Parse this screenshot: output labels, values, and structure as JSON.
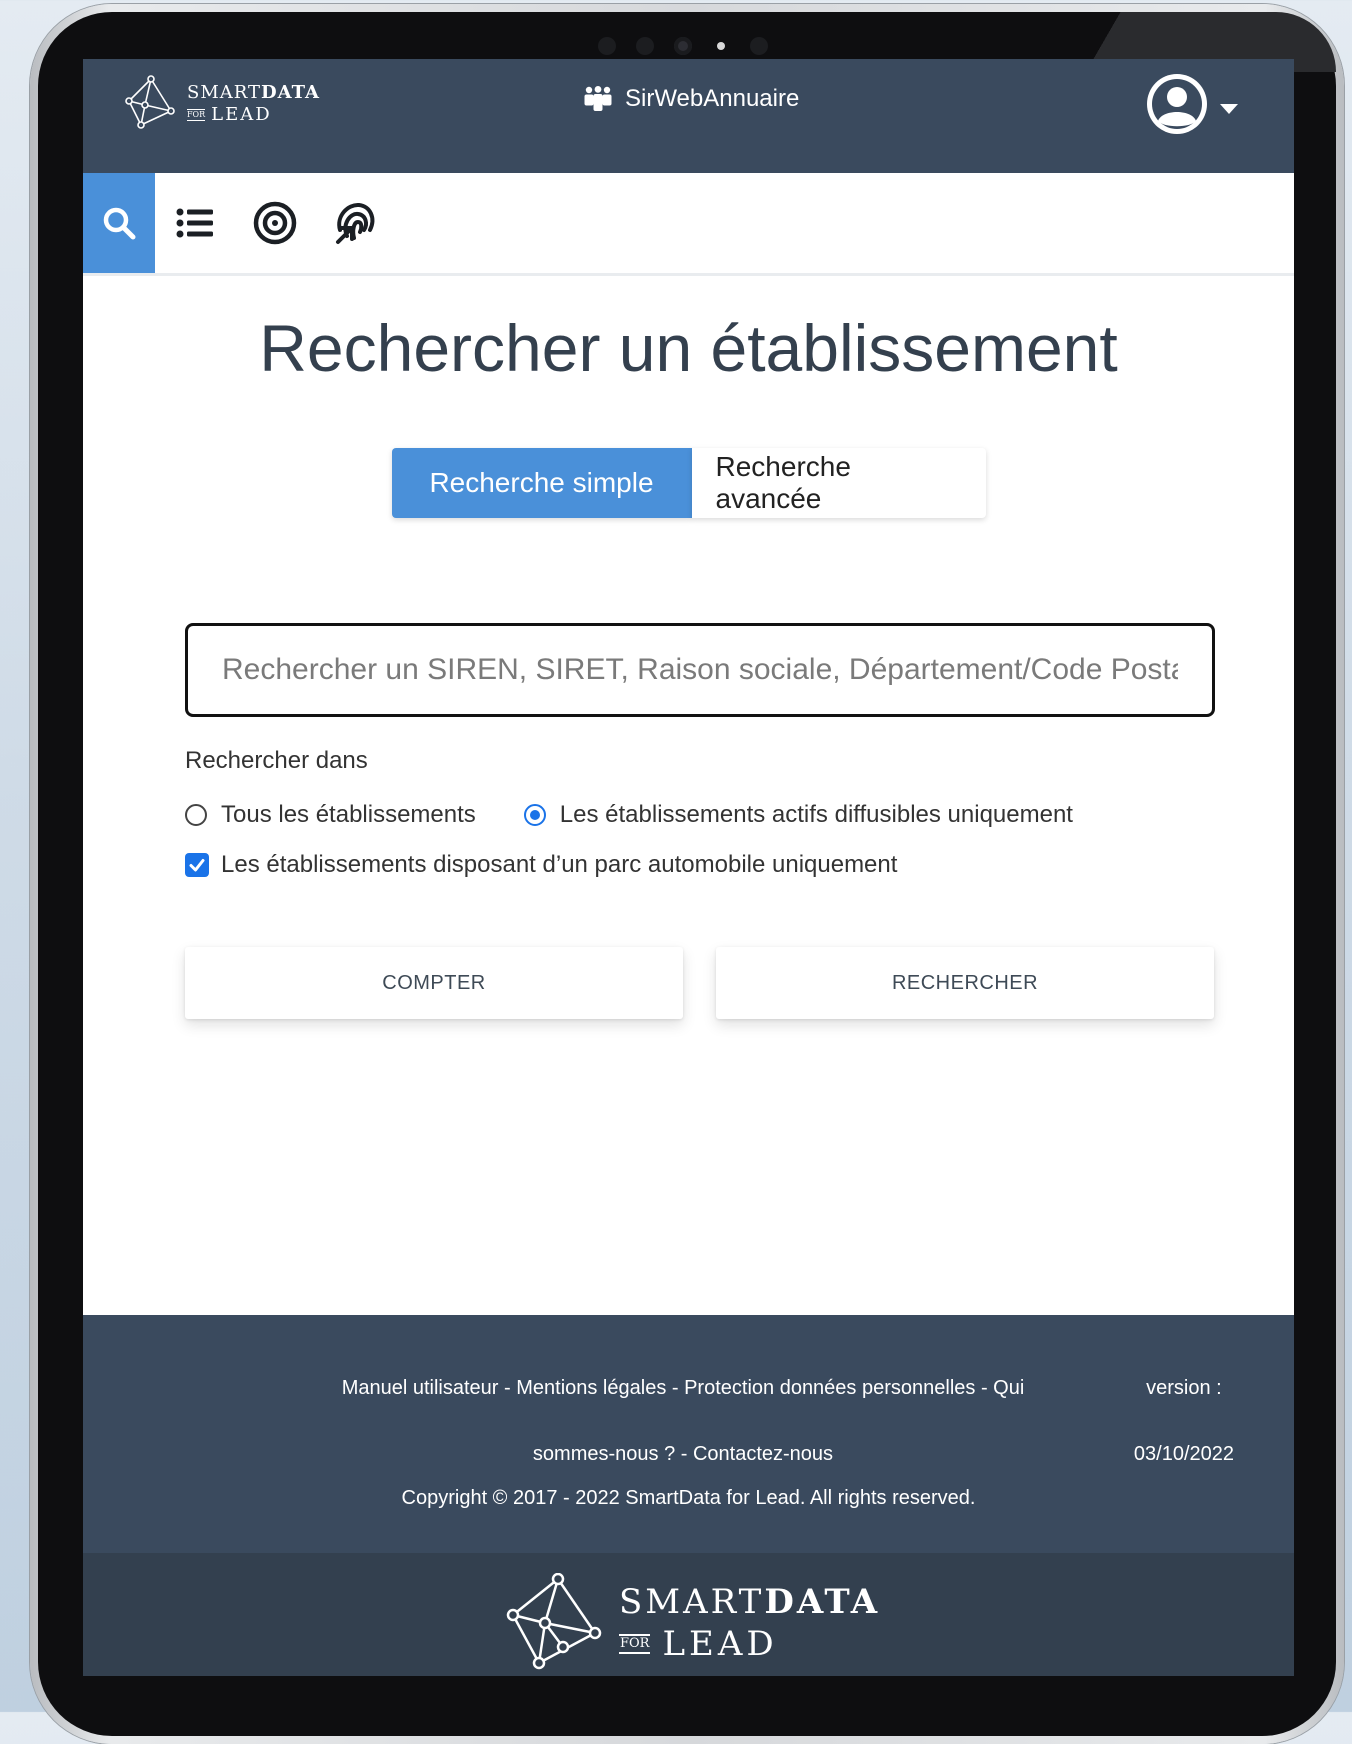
{
  "header": {
    "logo_line1_light": "SMART",
    "logo_line1_bold": "DATA",
    "logo_for": "FOR",
    "logo_line2": "LEAD",
    "app_title": "SirWebAnnuaire",
    "app_icon": "users-icon",
    "user_icon": "user-circle-icon"
  },
  "toolbar": {
    "items": [
      {
        "icon": "search-icon",
        "active": true
      },
      {
        "icon": "list-icon",
        "active": false
      },
      {
        "icon": "target-icon",
        "active": false
      },
      {
        "icon": "fingerprint-icon",
        "active": false
      }
    ]
  },
  "main": {
    "title": "Rechercher un établissement",
    "tabs": [
      {
        "label": "Recherche simple",
        "active": true
      },
      {
        "label": "Recherche avancée",
        "active": false
      }
    ],
    "search_placeholder": "Rechercher un SIREN, SIRET, Raison sociale, Département/Code Postal",
    "search_value": "",
    "search_in_label": "Rechercher dans",
    "radio_options": [
      {
        "label": "Tous les établissements",
        "checked": false
      },
      {
        "label": "Les établissements actifs diffusibles uniquement",
        "checked": true
      }
    ],
    "checkbox_label": "Les établissements disposant d’un parc automobile uniquement",
    "checkbox_checked": true,
    "count_button": "COMPTER",
    "search_button": "RECHERCHER"
  },
  "footer": {
    "links_line1": "Manuel utilisateur - Mentions légales - Protection données personnelles - Qui",
    "links_line2": "sommes-nous ? - Contactez-nous",
    "version_label": "version :",
    "version_date": "03/10/2022",
    "copyright": "Copyright © 2017 - 2022 SmartData for Lead. All rights reserved."
  },
  "colors": {
    "header_bg": "#3a4a5e",
    "accent": "#4a90d9",
    "checkbox": "#1a73e8"
  }
}
